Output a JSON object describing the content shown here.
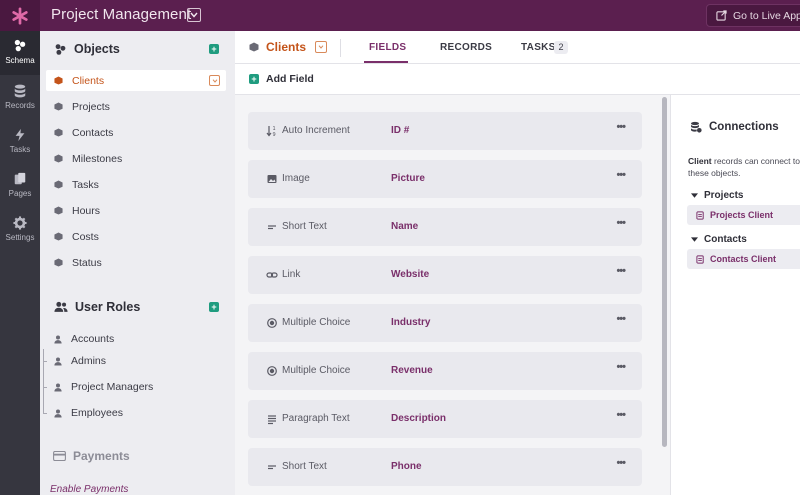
{
  "topbar": {
    "app_title": "Project Management",
    "live_button_label": "Go to Live App"
  },
  "leftnav": {
    "items": [
      {
        "label": "Schema",
        "icon": "schema-icon",
        "active": true
      },
      {
        "label": "Records",
        "icon": "database-icon"
      },
      {
        "label": "Tasks",
        "icon": "bolt-icon"
      },
      {
        "label": "Pages",
        "icon": "pages-icon"
      },
      {
        "label": "Settings",
        "icon": "gear-icon"
      }
    ]
  },
  "objects": {
    "title": "Objects",
    "items": [
      {
        "label": "Clients",
        "active": true
      },
      {
        "label": "Projects"
      },
      {
        "label": "Contacts"
      },
      {
        "label": "Milestones"
      },
      {
        "label": "Tasks"
      },
      {
        "label": "Hours"
      },
      {
        "label": "Costs"
      },
      {
        "label": "Status"
      }
    ]
  },
  "user_roles": {
    "title": "User Roles",
    "items": [
      {
        "label": "Accounts"
      },
      {
        "label": "Admins"
      },
      {
        "label": "Project Managers"
      },
      {
        "label": "Employees"
      }
    ]
  },
  "payments": {
    "title": "Payments",
    "enable_label": "Enable Payments"
  },
  "main": {
    "object_title": "Clients",
    "tabs": [
      {
        "label": "FIELDS",
        "active": true
      },
      {
        "label": "RECORDS"
      },
      {
        "label": "TASKS",
        "badge": "2"
      }
    ],
    "add_field_label": "Add Field",
    "fields": [
      {
        "type": "Auto Increment",
        "name": "ID #",
        "icon": "sort-numeric-icon"
      },
      {
        "type": "Image",
        "name": "Picture",
        "icon": "image-icon"
      },
      {
        "type": "Short Text",
        "name": "Name",
        "icon": "short-text-icon"
      },
      {
        "type": "Link",
        "name": "Website",
        "icon": "link-icon"
      },
      {
        "type": "Multiple Choice",
        "name": "Industry",
        "icon": "radio-icon"
      },
      {
        "type": "Multiple Choice",
        "name": "Revenue",
        "icon": "radio-icon"
      },
      {
        "type": "Paragraph Text",
        "name": "Description",
        "icon": "paragraph-icon"
      },
      {
        "type": "Short Text",
        "name": "Phone",
        "icon": "short-text-icon"
      }
    ],
    "more_label": "•••"
  },
  "connections": {
    "title": "Connections",
    "desc_bold": "Client",
    "desc_rest": " records can connect to these objects.",
    "groups": [
      {
        "label": "Projects",
        "link": "Projects Client"
      },
      {
        "label": "Contacts",
        "link": "Contacts Client"
      }
    ]
  },
  "colors": {
    "brand": "#5b1f4f",
    "accent": "#7a2f6a",
    "active_object": "#c4541a",
    "add_green": "#1f9c7f"
  }
}
